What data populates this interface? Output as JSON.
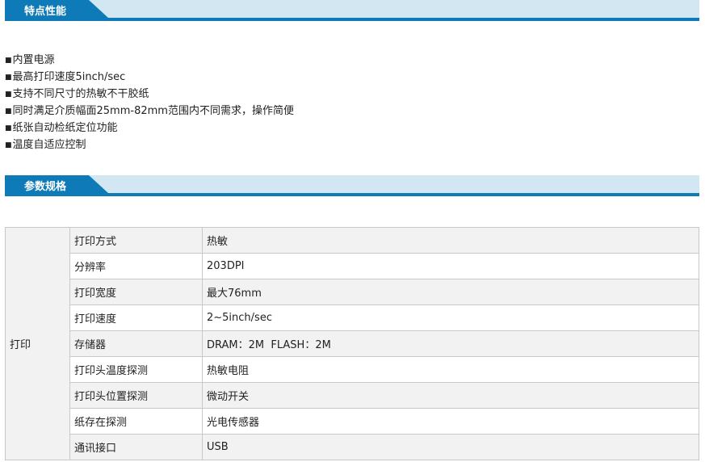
{
  "section1": {
    "title": "特点性能"
  },
  "features": [
    "内置电源",
    "最高打印速度5inch/sec",
    "支持不同尺寸的热敏不干胶纸",
    "同时满足介质幅面25mm-82mm范围内不同需求，操作简便",
    "纸张自动检纸定位功能",
    "温度自适应控制"
  ],
  "bullet": "■",
  "section2": {
    "title": "参数规格"
  },
  "spec": {
    "group": "打印",
    "rows": [
      {
        "label": "打印方式",
        "value": "热敏"
      },
      {
        "label": "分辨率",
        "value": "203DPI"
      },
      {
        "label": "打印宽度",
        "value": "最大76mm"
      },
      {
        "label": "打印速度",
        "value": "2~5inch/sec"
      },
      {
        "label": "存储器",
        "value": "DRAM：2M  FLASH：2M"
      },
      {
        "label": "打印头温度探测",
        "value": "热敏电阻"
      },
      {
        "label": "打印头位置探测",
        "value": "微动开关"
      },
      {
        "label": "纸存在探测",
        "value": "光电传感器"
      },
      {
        "label": "通讯接口",
        "value": "USB"
      }
    ]
  },
  "colors": {
    "accent": "#0e7ab8",
    "header_band": "#d3e7f2",
    "row_alt": "#f2f2f2"
  }
}
